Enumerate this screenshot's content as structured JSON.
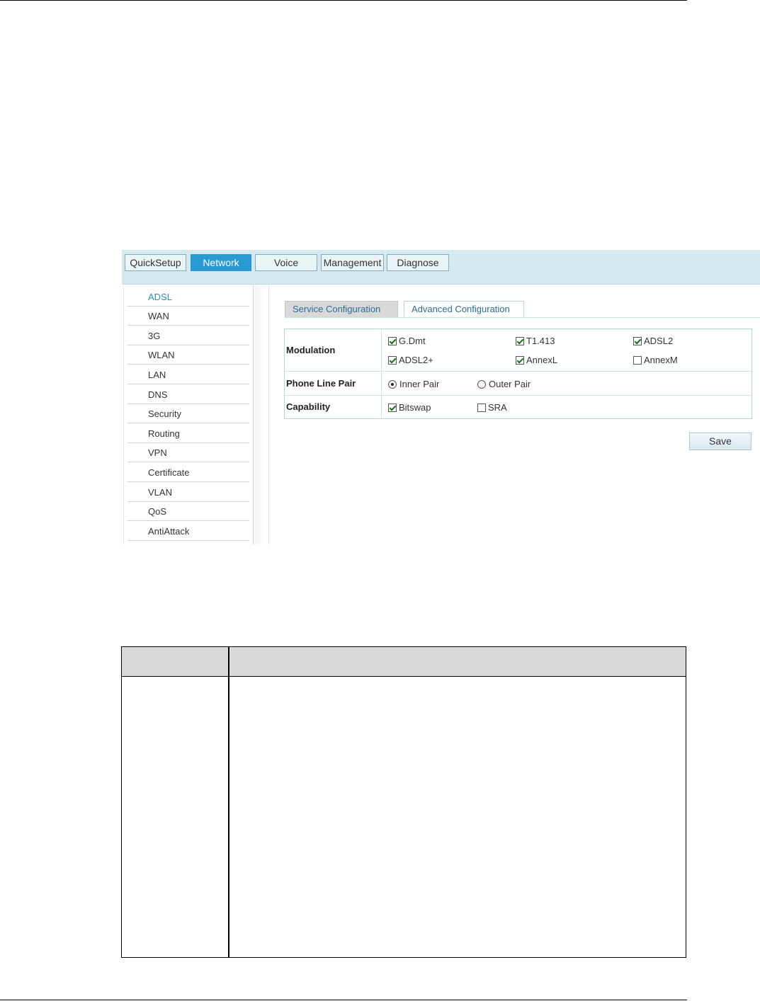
{
  "top_nav": {
    "tabs": [
      {
        "label": "QuickSetup"
      },
      {
        "label": "Network"
      },
      {
        "label": "Voice"
      },
      {
        "label": "Management"
      },
      {
        "label": "Diagnose"
      }
    ],
    "active": "Network"
  },
  "sidebar": {
    "items": [
      {
        "label": "ADSL"
      },
      {
        "label": "WAN"
      },
      {
        "label": "3G"
      },
      {
        "label": "WLAN"
      },
      {
        "label": "LAN"
      },
      {
        "label": "DNS"
      },
      {
        "label": "Security"
      },
      {
        "label": "Routing"
      },
      {
        "label": "VPN"
      },
      {
        "label": "Certificate"
      },
      {
        "label": "VLAN"
      },
      {
        "label": "QoS"
      },
      {
        "label": "AntiAttack"
      }
    ],
    "active": "ADSL"
  },
  "subtabs": [
    {
      "label": "Service Configuration"
    },
    {
      "label": "Advanced Configuration"
    }
  ],
  "active_subtab": "Advanced Configuration",
  "form": {
    "modulation": {
      "label": "Modulation",
      "options": [
        {
          "label": "G.Dmt",
          "checked": true
        },
        {
          "label": "T1.413",
          "checked": true
        },
        {
          "label": "ADSL2",
          "checked": true
        },
        {
          "label": "ADSL2+",
          "checked": true
        },
        {
          "label": "AnnexL",
          "checked": true
        },
        {
          "label": "AnnexM",
          "checked": false
        }
      ]
    },
    "phone_line_pair": {
      "label": "Phone Line Pair",
      "options": [
        {
          "label": "Inner Pair",
          "selected": true
        },
        {
          "label": "Outer Pair",
          "selected": false
        }
      ]
    },
    "capability": {
      "label": "Capability",
      "options": [
        {
          "label": "Bitswap",
          "checked": true
        },
        {
          "label": "SRA",
          "checked": false
        }
      ]
    },
    "save_label": "Save"
  },
  "colors": {
    "nav_bg": "#d4eaf0",
    "active_tab": "#2a9bd2",
    "accent_text": "#2c8fb5",
    "table_header_bg": "#d9d9d9"
  }
}
